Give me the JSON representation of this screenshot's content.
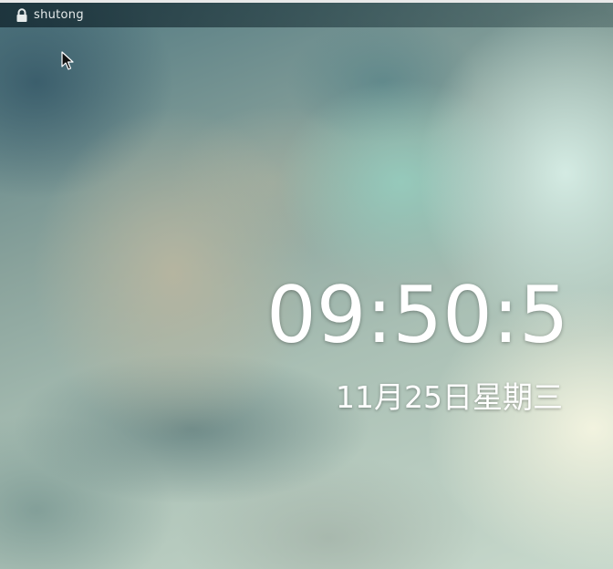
{
  "top_bar": {
    "username": "shutong",
    "lock_icon": "lock-icon"
  },
  "lock_screen": {
    "time": "09:50:5",
    "date": "11月25日星期三"
  },
  "pointer": {
    "icon": "cursor-arrow-icon"
  },
  "colors": {
    "text": "#ffffff",
    "bar_text": "#e6ebeb"
  }
}
